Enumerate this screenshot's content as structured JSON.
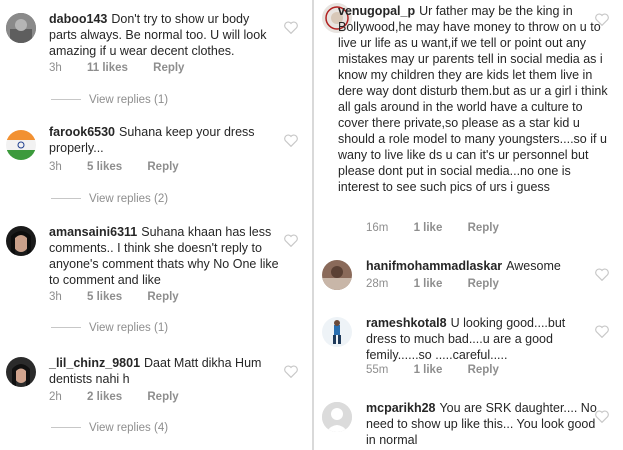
{
  "left": [
    {
      "user": "daboo143",
      "text": "Don't try to show ur body parts always. Be normal too. U will look amazing if u wear decent clothes.",
      "time": "3h",
      "likes": "11 likes",
      "reply": "Reply",
      "view": "View replies (1)"
    },
    {
      "user": "farook6530",
      "text": "Suhana keep your dress properly...",
      "time": "3h",
      "likes": "5 likes",
      "reply": "Reply",
      "view": "View replies (2)"
    },
    {
      "user": "amansaini6311",
      "text": "Suhana khaan has less comments.. I think she doesn't reply to anyone's comment thats why No One like to comment and like",
      "time": "3h",
      "likes": "5 likes",
      "reply": "Reply",
      "view": "View replies (1)"
    },
    {
      "user": "_lil_chinz_9801",
      "text": "Daat Matt dikha Hum dentists nahi h",
      "time": "2h",
      "likes": "2 likes",
      "reply": "Reply",
      "view": "View replies (4)"
    }
  ],
  "right": [
    {
      "user": "venugopal_p",
      "text": "Ur father may be the king in Bollywood,he may have money to throw on u to live ur life as u want,if we tell or point out any mistakes may ur parents tell in social media as i know my children they are kids let them live in dere way dont disturb them.but as ur a girl i think all gals around in the world have a culture to cover there private,so please as a star kid u should a role model to many youngsters....so if u wany to live like ds u can it's ur personnel but please dont put in social media...no one is interest to see such pics of urs i guess",
      "time": "16m",
      "likes": "1 like",
      "reply": "Reply"
    },
    {
      "user": "hanifmohammadlaskar",
      "text": "Awesome",
      "time": "28m",
      "likes": "1 like",
      "reply": "Reply"
    },
    {
      "user": "rameshkotal8",
      "text": "U looking good....but dress to much bad....u are a good femily......so .....careful.....",
      "time": "55m",
      "likes": "1 like",
      "reply": "Reply"
    },
    {
      "user": "mcparikh28",
      "text": "You are SRK daughter.... No need to show up like this... You look good in normal"
    }
  ],
  "colors": {
    "username": "#262626",
    "meta": "#8e8e8e",
    "heart": "#c7c7c7"
  }
}
